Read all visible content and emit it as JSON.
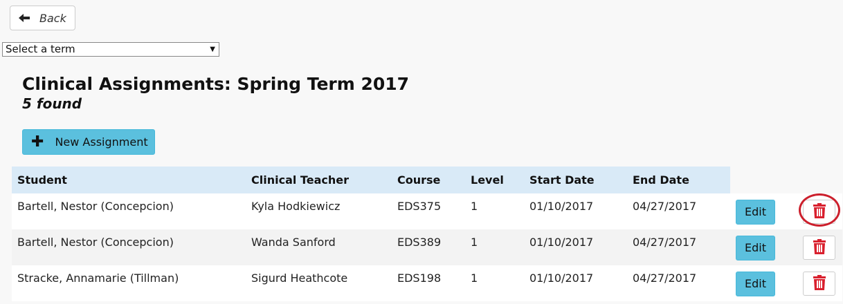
{
  "back_button": {
    "label": "Back",
    "icon": "arrow-left-icon"
  },
  "term_select": {
    "selected": "Select a term"
  },
  "header": {
    "title": "Clinical Assignments: Spring Term 2017",
    "count": "5 found"
  },
  "new_button": {
    "label": "New Assignment",
    "icon": "plus-icon"
  },
  "table": {
    "columns": [
      "Student",
      "Clinical Teacher",
      "Course",
      "Level",
      "Start Date",
      "End Date"
    ],
    "rows": [
      {
        "student": "Bartell, Nestor (Concepcion)",
        "teacher": "Kyla Hodkiewicz",
        "course": "EDS375",
        "level": "1",
        "start": "01/10/2017",
        "end": "04/27/2017",
        "edit": "Edit"
      },
      {
        "student": "Bartell, Nestor (Concepcion)",
        "teacher": "Wanda Sanford",
        "course": "EDS389",
        "level": "1",
        "start": "01/10/2017",
        "end": "04/27/2017",
        "edit": "Edit"
      },
      {
        "student": "Stracke, Annamarie (Tillman)",
        "teacher": "Sigurd Heathcote",
        "course": "EDS198",
        "level": "1",
        "start": "01/10/2017",
        "end": "04/27/2017",
        "edit": "Edit"
      }
    ]
  },
  "colors": {
    "accent": "#5bc0de",
    "header_bg": "#d9eaf7",
    "delete_red": "#d9202e",
    "highlight": "#cc1f2c"
  }
}
